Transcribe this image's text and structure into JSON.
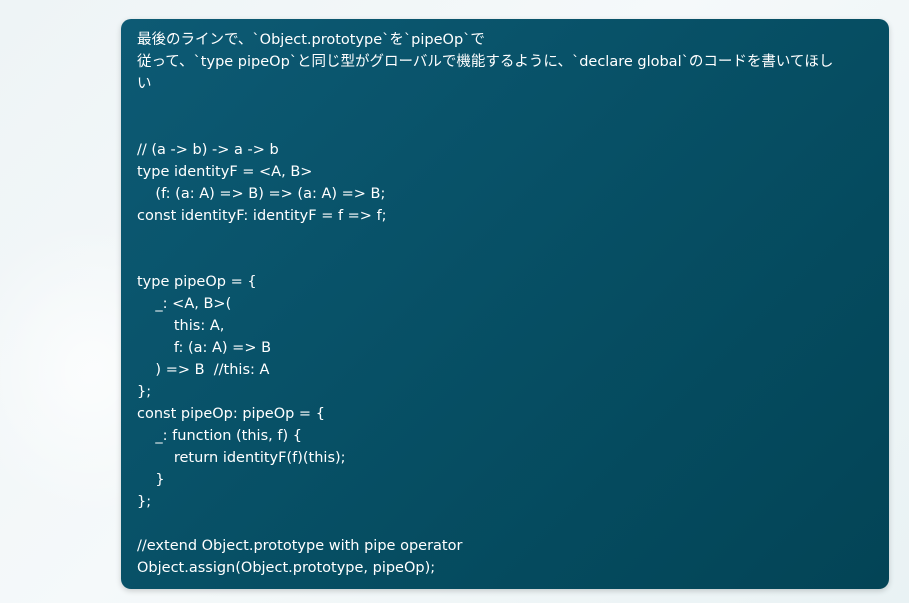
{
  "message": {
    "lines": [
      "最後のラインで、`Object.prototype`を`pipeOp`で",
      "従って、`type pipeOp`と同じ型がグローバルで機能するように、`declare global`のコードを書いてほし",
      "い",
      "",
      "",
      "// (a -> b) -> a -> b",
      "type identityF = <A, B>",
      "    (f: (a: A) => B) => (a: A) => B;",
      "const identityF: identityF = f => f;",
      "",
      "",
      "type pipeOp = {",
      "    _: <A, B>(",
      "        this: A,",
      "        f: (a: A) => B",
      "    ) => B  //this: A",
      "};",
      "const pipeOp: pipeOp = {",
      "    _: function (this, f) {",
      "        return identityF(f)(this);",
      "    }",
      "};",
      "",
      "//extend Object.prototype with pipe operator",
      "Object.assign(Object.prototype, pipeOp);"
    ]
  }
}
